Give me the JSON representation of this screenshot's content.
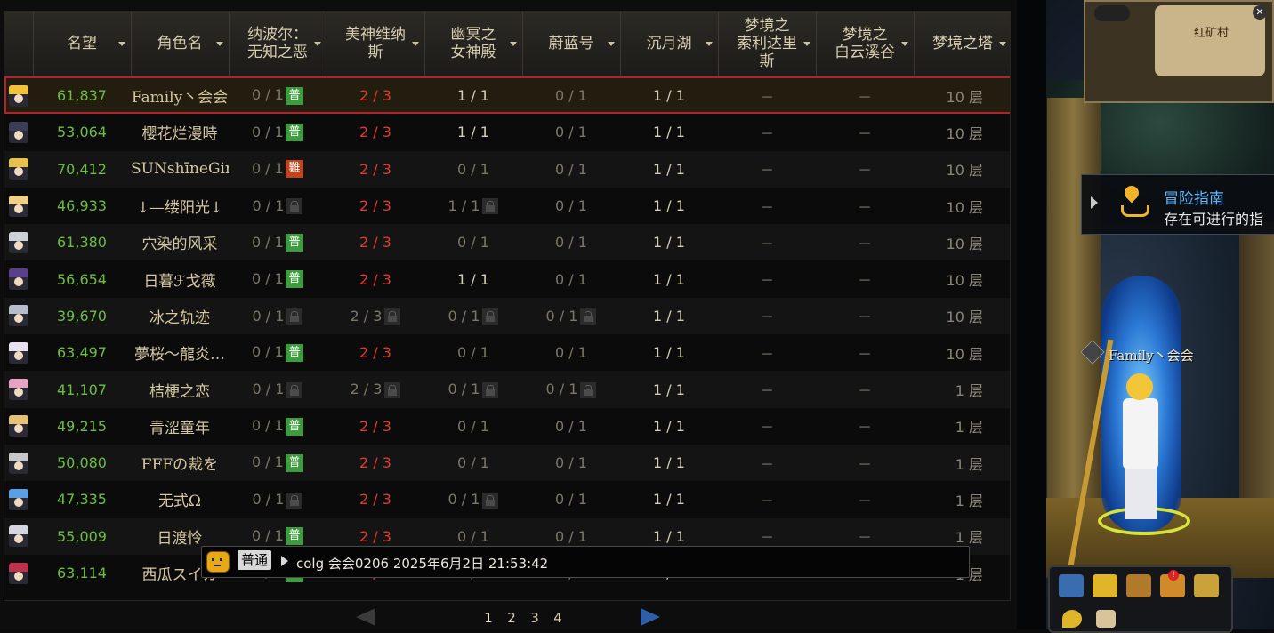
{
  "columns": [
    {
      "key": "avatar",
      "label": ""
    },
    {
      "key": "fame",
      "label": "名望"
    },
    {
      "key": "name",
      "label": "角色名"
    },
    {
      "key": "d1",
      "label": "纳波尔：\n无知之恶"
    },
    {
      "key": "d2",
      "label": "美神维纳\n斯"
    },
    {
      "key": "d3",
      "label": "幽冥之\n女神殿"
    },
    {
      "key": "d4",
      "label": "蔚蓝号"
    },
    {
      "key": "d5",
      "label": "沉月湖"
    },
    {
      "key": "d6",
      "label": "梦境之\n索利达里\n斯"
    },
    {
      "key": "d7",
      "label": "梦境之\n白云溪谷"
    },
    {
      "key": "d8",
      "label": "梦境之塔"
    }
  ],
  "rows": [
    {
      "fame": "61,837",
      "name": "Family丶会会",
      "d1": "0 / 1",
      "d1b": "普",
      "d2": "2 / 3",
      "d2s": "red",
      "d3": "1 / 1",
      "d3s": "on",
      "d4": "0 / 1",
      "d5": "1 / 1",
      "d6": "－",
      "d7": "－",
      "d8": "10 层",
      "selected": true,
      "color": "#f2c33a"
    },
    {
      "fame": "53,064",
      "name": "樱花烂漫時",
      "d1": "0 / 1",
      "d1b": "普",
      "d2": "2 / 3",
      "d2s": "red",
      "d3": "1 / 1",
      "d3s": "on",
      "d4": "0 / 1",
      "d5": "1 / 1",
      "d6": "－",
      "d7": "－",
      "d8": "10 层",
      "color": "#3b3c55"
    },
    {
      "fame": "70,412",
      "name": "SUNshīneGir",
      "d1": "0 / 1",
      "d1b": "難",
      "d2": "2 / 3",
      "d2s": "red",
      "d3": "0 / 1",
      "d3s": "dim",
      "d4": "0 / 1",
      "d5": "1 / 1",
      "d6": "－",
      "d7": "－",
      "d8": "10 层",
      "color": "#e7c24a"
    },
    {
      "fame": "46,933",
      "name": "↓—缕阳光↓",
      "d1": "0 / 1",
      "d1b": "lock",
      "d2": "2 / 3",
      "d2s": "red",
      "d3": "1 / 1",
      "d3s": "lock",
      "d4": "0 / 1",
      "d5": "1 / 1",
      "d6": "－",
      "d7": "－",
      "d8": "10 层",
      "color": "#f0d089"
    },
    {
      "fame": "61,380",
      "name": "穴染的风采",
      "d1": "0 / 1",
      "d1b": "普",
      "d2": "2 / 3",
      "d2s": "red",
      "d3": "0 / 1",
      "d3s": "dim",
      "d4": "0 / 1",
      "d5": "1 / 1",
      "d6": "－",
      "d7": "－",
      "d8": "10 层",
      "color": "#cfd1d8"
    },
    {
      "fame": "56,654",
      "name": "日暮ℱ戈薇",
      "d1": "0 / 1",
      "d1b": "普",
      "d2": "2 / 3",
      "d2s": "red",
      "d3": "1 / 1",
      "d3s": "on",
      "d4": "0 / 1",
      "d5": "1 / 1",
      "d6": "－",
      "d7": "－",
      "d8": "10 层",
      "color": "#5a3f8a"
    },
    {
      "fame": "39,670",
      "name": "冰之轨迹",
      "d1": "0 / 1",
      "d1b": "lock",
      "d2": "2 / 3",
      "d2s": "lockdim",
      "d3": "0 / 1",
      "d3s": "lock",
      "d4": "0 / 1",
      "d4s": "lock",
      "d5": "1 / 1",
      "d6": "－",
      "d7": "－",
      "d8": "10 层",
      "color": "#b7bccd"
    },
    {
      "fame": "63,497",
      "name": "夢桜～龍炎…",
      "d1": "0 / 1",
      "d1b": "普",
      "d2": "2 / 3",
      "d2s": "red",
      "d3": "0 / 1",
      "d3s": "dim",
      "d4": "0 / 1",
      "d5": "1 / 1",
      "d6": "－",
      "d7": "－",
      "d8": "10 层",
      "color": "#e9e3ef"
    },
    {
      "fame": "41,107",
      "name": "桔梗之恋",
      "d1": "0 / 1",
      "d1b": "lock",
      "d2": "2 / 3",
      "d2s": "lockdim",
      "d3": "0 / 1",
      "d3s": "lock",
      "d4": "0 / 1",
      "d4s": "lock",
      "d5": "1 / 1",
      "d6": "－",
      "d7": "－",
      "d8": "1 层",
      "color": "#e7a3c4"
    },
    {
      "fame": "49,215",
      "name": "青涩童年",
      "d1": "0 / 1",
      "d1b": "普",
      "d2": "2 / 3",
      "d2s": "red",
      "d3": "0 / 1",
      "d3s": "dim",
      "d4": "0 / 1",
      "d5": "1 / 1",
      "d6": "－",
      "d7": "－",
      "d8": "1 层",
      "color": "#e6c173"
    },
    {
      "fame": "50,080",
      "name": "FFFの裁を",
      "d1": "0 / 1",
      "d1b": "普",
      "d2": "2 / 3",
      "d2s": "red",
      "d3": "0 / 1",
      "d3s": "dim",
      "d4": "0 / 1",
      "d5": "1 / 1",
      "d6": "－",
      "d7": "－",
      "d8": "1 层",
      "color": "#c8c8c8"
    },
    {
      "fame": "47,335",
      "name": "无式Ω",
      "d1": "0 / 1",
      "d1b": "lock",
      "d2": "2 / 3",
      "d2s": "red",
      "d3": "0 / 1",
      "d3s": "lock",
      "d4": "0 / 1",
      "d5": "1 / 1",
      "d6": "－",
      "d7": "－",
      "d8": "1 层",
      "color": "#5aa0e6"
    },
    {
      "fame": "55,009",
      "name": "日渡怜",
      "d1": "0 / 1",
      "d1b": "普",
      "d2": "2 / 3",
      "d2s": "red",
      "d3": "0 / 1",
      "d3s": "dim",
      "d4": "0 / 1",
      "d5": "1 / 1",
      "d6": "－",
      "d7": "－",
      "d8": "1 层",
      "color": "#d4d6e2"
    },
    {
      "fame": "63,114",
      "name": "西瓜スイカ",
      "d1": "0 / 1",
      "d1b": "普",
      "d2": "2 / 3",
      "d2s": "red",
      "d3": "0 / 1",
      "d3s": "dim",
      "d4": "0 / 1",
      "d5": "1 / 1",
      "d6": "－",
      "d7": "－",
      "d8": "1 层",
      "color": "#c0304a"
    }
  ],
  "pager": {
    "pages": [
      "1",
      "2",
      "3",
      "4"
    ],
    "current": "1"
  },
  "chat": {
    "channel": "普通",
    "message": "colg 会会0206 2025年6月2日 21:53:42"
  },
  "minimap": {
    "town": "红矿村",
    "close": "✕"
  },
  "guide": {
    "title": "冒险指南",
    "subtitle": "存在可进行的指"
  },
  "character": {
    "name": "Family丶会会"
  },
  "dock": {
    "alert": "!"
  },
  "colors": {
    "accent_red": "#b3232b",
    "fame_green": "#6bbf3a",
    "clear_red": "#e03a2a",
    "badge_green": "#3d9c3d",
    "badge_orange": "#c0441b",
    "guide_blue": "#5cb8ff"
  }
}
